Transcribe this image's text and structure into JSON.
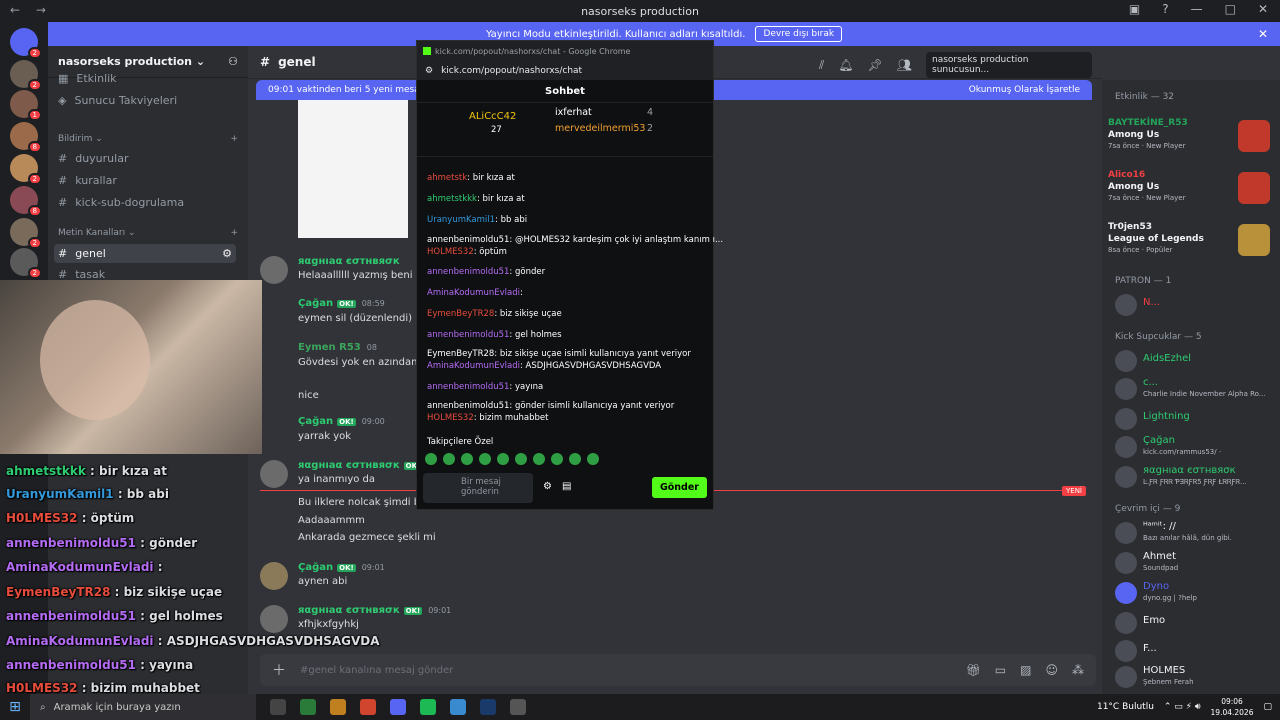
{
  "window": {
    "title": "nasorseks production"
  },
  "banner": {
    "text": "Yayıncı Modu etkinleştirildi. Kullanıcı adları kısaltıldı.",
    "button": "Devre dışı bırak"
  },
  "server": {
    "name": "nasorseks production"
  },
  "channels": {
    "top": [
      {
        "label": "Etkinlik"
      },
      {
        "label": "Sunucu Takviyeleri"
      }
    ],
    "cat_info": "Bildirim",
    "info": [
      {
        "label": "duyurular"
      },
      {
        "label": "kurallar"
      },
      {
        "label": "kick-sub-dogrulama"
      }
    ],
    "cat_text": "Metin Kanalları",
    "text": [
      {
        "label": "genel"
      },
      {
        "label": "tasak"
      }
    ]
  },
  "header": {
    "channel": "genel",
    "search_placeholder": "nasorseks production sunucusun..."
  },
  "new_messages": {
    "text": "09:01 vaktinden beri 5 yeni mesaj",
    "mark": "Okunmuş Olarak İşaretle"
  },
  "messages": [
    {
      "name": "яαgнıaα єσтнвяσк",
      "color": "#2ecc71",
      "time": "",
      "lines": [
        "Helaaallllll yazmış beni ciğe"
      ]
    },
    {
      "name": "Çağan",
      "color": "#2ecc71",
      "time": "08:59",
      "lines": [
        "eymen sil (düzenlendi)"
      ]
    },
    {
      "name": "Eymen R53",
      "color": "#3ba55c",
      "time": "08",
      "lines": [
        "Gövdesi yok en azından",
        "nice"
      ]
    },
    {
      "name": "Çağan",
      "color": "#2ecc71",
      "time": "09:00",
      "lines": [
        "yarrak yok"
      ]
    },
    {
      "name": "яαgнıaα єσтнвяσк",
      "color": "#2ecc71",
      "time": "",
      "lines": [
        "ya inanmıyo da"
      ]
    },
    {
      "name": "",
      "color": "#2ecc71",
      "time": "",
      "lines": [
        "Bu ilklere nolcak şimdi beb",
        "Aadaaammm",
        "Ankarada gezmece şekli mi"
      ]
    },
    {
      "name": "Çağan",
      "color": "#2ecc71",
      "time": "09:01",
      "lines": [
        "aynen abi"
      ]
    },
    {
      "name": "яαgнıaα єσтнвяσк",
      "color": "#2ecc71",
      "time": "09:01",
      "lines": [
        "xfhjkxfgyhkj"
      ]
    }
  ],
  "new_label": "YENİ",
  "composer": {
    "placeholder": "#genel kanalına mesaj gönder"
  },
  "activity": {
    "header": "Etkinlik — 32",
    "items": [
      {
        "name": "BAYTEKİNE_R53",
        "game": "Among Us",
        "sub": "7sa önce · New Player",
        "color": "#c0392b"
      },
      {
        "name": "Alico16",
        "game": "Among Us",
        "sub": "7sa önce · New Player",
        "color": "#c0392b"
      },
      {
        "name": "Tr0jen53",
        "game": "League of Legends",
        "sub": "8sa önce · Popüler",
        "color": "#b8913a"
      }
    ]
  },
  "members": {
    "patron_header": "PATRON — 1",
    "patron": [
      {
        "name": "N...",
        "status": "",
        "color": "#f23f43"
      }
    ],
    "supporters_header": "Kick Supcuklar — 5",
    "supporters": [
      {
        "name": "AidsEzhel",
        "status": "",
        "color": "#2ecc71"
      },
      {
        "name": "c...",
        "status": "Charlie Indie November Alpha Ro...",
        "color": "#2ecc71"
      },
      {
        "name": "Lightning",
        "status": "",
        "color": "#2ecc71"
      },
      {
        "name": "Çağan",
        "status": "kick.com/rammus53/ ·",
        "color": "#2ecc71"
      },
      {
        "name": "яαgнıaα єσтнвяσк",
        "status": "Ŀ.ƑᏒ ƑᏒᏒ ƤƎᏒƑᏒ5 ƑᏒƑ ŁᏒᏒƑᏒ...",
        "color": "#2ecc71"
      }
    ],
    "online_header": "Çevrim içi — 9",
    "online": [
      {
        "name": "ᴴᵃᵐⁱᵗ: //",
        "status": "Bazı anılar hâlâ, dün gibi.",
        "color": "#f2f3f5"
      },
      {
        "name": "Ahmet",
        "status": "Soundpad",
        "color": "#f2f3f5"
      },
      {
        "name": "Dyno",
        "status": "dyno.gg | ?help",
        "color": "#5865f2"
      },
      {
        "name": "Emo",
        "status": "",
        "color": "#f2f3f5"
      },
      {
        "name": "F...",
        "status": "",
        "color": "#f2f3f5"
      },
      {
        "name": "HOLMES",
        "status": "Şebnem Ferah",
        "color": "#f2f3f5"
      }
    ]
  },
  "popup": {
    "title": "kick.com/popout/nashorxs/chat - Google Chrome",
    "url": "kick.com/popout/nashorxs/chat",
    "tab": "Sohbet",
    "leader1": "ALiCcC42",
    "leader1_count": "27",
    "leader2": "ixferhat",
    "leader2_count": "4",
    "leader3": "mervedeilmermi53",
    "leader3_count": "2",
    "lines": [
      {
        "user": "ahmetstk",
        "color": "#e74c3c",
        "text": ": bir kıza at",
        "reply": ""
      },
      {
        "user": "ahmetstkkk",
        "color": "#2ecc71",
        "text": ": bir kıza at",
        "reply": ""
      },
      {
        "user": "UranyumKamil1",
        "color": "#3498db",
        "text": ": bb abi",
        "reply": ""
      },
      {
        "user": "HOLMES32",
        "color": "#e74c3c",
        "text": ": öptüm",
        "reply": "annenbenimoldu51: @HOLMES32 kardeşim çok iyi anlaştım kanım ı..."
      },
      {
        "user": "annenbenimoldu51",
        "color": "#b46cf4",
        "text": ": gönder",
        "reply": ""
      },
      {
        "user": "AminaKodumunEvladi",
        "color": "#b46cf4",
        "text": ":",
        "reply": ""
      },
      {
        "user": "EymenBeyTR28",
        "color": "#e74c3c",
        "text": ": biz sikişe uçae",
        "reply": ""
      },
      {
        "user": "annenbenimoldu51",
        "color": "#b46cf4",
        "text": ": gel holmes",
        "reply": ""
      },
      {
        "user": "AminaKodumunEvladi",
        "color": "#b46cf4",
        "text": ": ASDJHGASVDHGASVDHSAGVDA",
        "reply": "EymenBeyTR28: biz sikişe uçae isimli kullanıcıya yanıt veriyor"
      },
      {
        "user": "annenbenimoldu51",
        "color": "#b46cf4",
        "text": ": yayına",
        "reply": ""
      },
      {
        "user": "HOLMES32",
        "color": "#e74c3c",
        "text": ": bizim muhabbet",
        "reply": "annenbenimoldu51: gönder isimli kullanıcıya yanıt veriyor"
      }
    ],
    "followers_label": "Takipçilere Özel",
    "input_placeholder": "Bir mesaj gönderin",
    "send": "Gönder"
  },
  "overlay": [
    {
      "user": "ahmetstkkk",
      "color": "#2ecc71",
      "text": " : bir kıza at"
    },
    {
      "user": "UranyumKamil1",
      "color": "#3498db",
      "text": " : bb abi"
    },
    {
      "user": "H0LMES32",
      "color": "#e74c3c",
      "text": " : öptüm"
    },
    {
      "user": "annenbenimoldu51",
      "color": "#b46cf4",
      "text": " : gönder"
    },
    {
      "user": "AminaKodumunEvladi",
      "color": "#b46cf4",
      "text": " :"
    },
    {
      "user": "EymenBeyTR28",
      "color": "#e74c3c",
      "text": " : biz sikişe uçae"
    },
    {
      "user": "annenbenimoldu51",
      "color": "#b46cf4",
      "text": " : gel holmes"
    },
    {
      "user": "AminaKodumunEvladi",
      "color": "#b46cf4",
      "text": " : ASDJHGASVDHGASVDHSAGVDA"
    },
    {
      "user": "annenbenimoldu51",
      "color": "#b46cf4",
      "text": " : yayına"
    },
    {
      "user": "H0LMES32",
      "color": "#e74c3c",
      "text": " : bizim muhabbet"
    }
  ],
  "taskbar": {
    "search": "Aramak için buraya yazın",
    "weather": "11°C  Bulutlu",
    "time": "09:06",
    "date": "19.04.2026"
  }
}
